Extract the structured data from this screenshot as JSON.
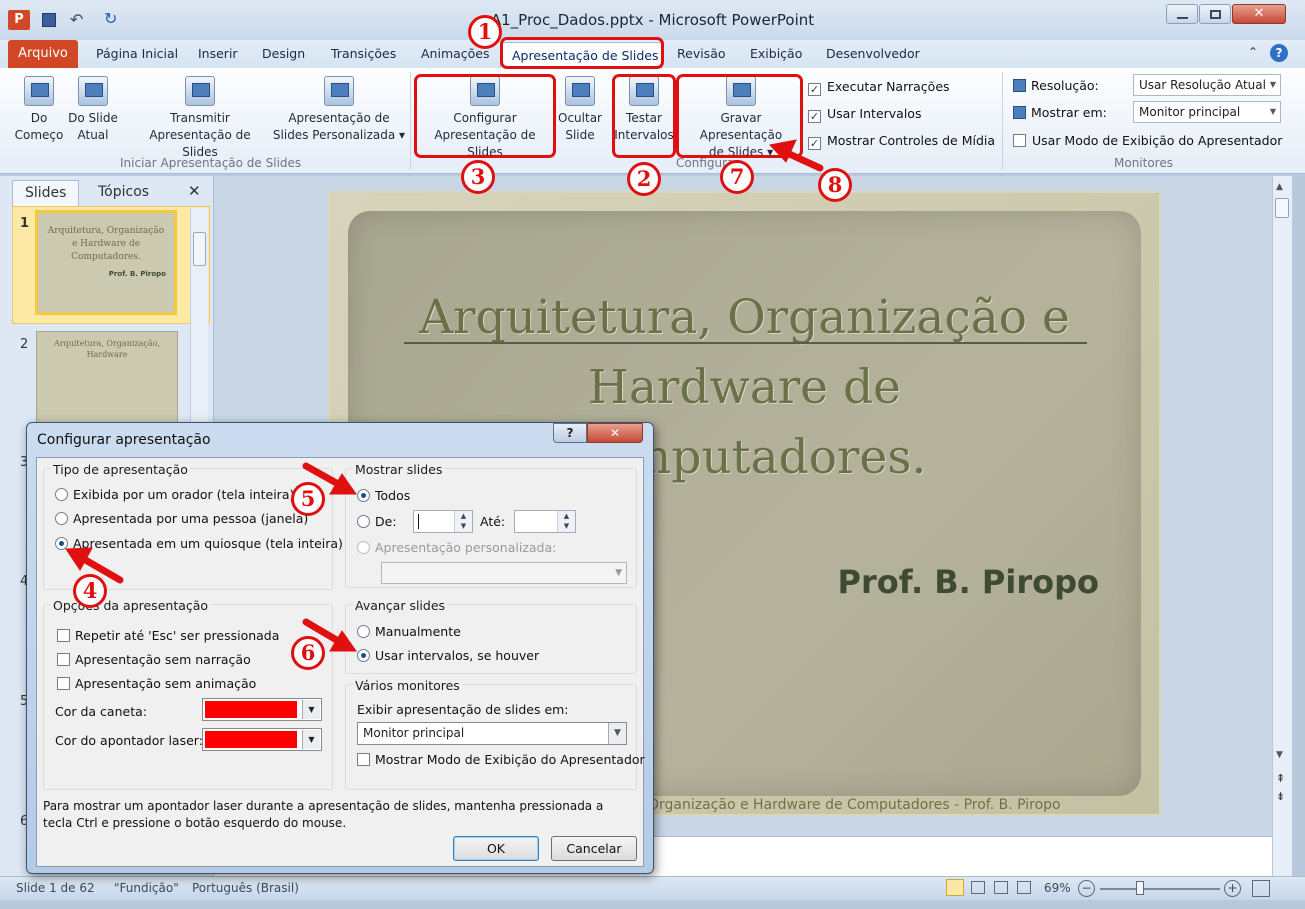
{
  "window": {
    "title": "A1_Proc_Dados.pptx - Microsoft PowerPoint",
    "app_icon": "P"
  },
  "ribbon_tabs": [
    "Arquivo",
    "Página Inicial",
    "Inserir",
    "Design",
    "Transições",
    "Animações",
    "Apresentação de Slides",
    "Revisão",
    "Exibição",
    "Desenvolvedor"
  ],
  "ribbon": {
    "btn_inicio": [
      "Do",
      "Começo"
    ],
    "btn_slide_atual": [
      "Do Slide",
      "Atual"
    ],
    "btn_transmitir": [
      "Transmitir",
      "Apresentação de Slides"
    ],
    "btn_personalizada": [
      "Apresentação de",
      "Slides Personalizada"
    ],
    "group_iniciar": "Iniciar Apresentação de Slides",
    "btn_configurar": [
      "Configurar",
      "Apresentação de Slides"
    ],
    "btn_ocultar": [
      "Ocultar",
      "Slide"
    ],
    "btn_testar": [
      "Testar",
      "Intervalos"
    ],
    "btn_gravar": [
      "Gravar Apresentação",
      "de Slides"
    ],
    "group_configurar": "Configurar",
    "chk_narracoes": "Executar Narrações",
    "chk_intervalos": "Usar Intervalos",
    "chk_controles": "Mostrar Controles de Mídia",
    "resolucao_label": "Resolução:",
    "resolucao_value": "Usar Resolução Atual",
    "mostrar_em_label": "Mostrar em:",
    "mostrar_em_value": "Monitor principal",
    "chk_modo_apresentador": "Usar Modo de Exibição do Apresentador",
    "group_monitores": "Monitores"
  },
  "annotations": [
    "1",
    "2",
    "3",
    "4",
    "5",
    "6",
    "7",
    "8"
  ],
  "left_pane": {
    "tab_slides": "Slides",
    "tab_topicos": "Tópicos",
    "close": "✕",
    "slide_numbers": [
      "1",
      "2",
      "3",
      "4",
      "5",
      "6"
    ],
    "thumb1_title": "Arquitetura, Organização e Hardware de Computadores.",
    "thumb1_author": "Prof. B. Piropo",
    "thumb2_title": "Arquitetura, Organização, Hardware"
  },
  "slide": {
    "title_lines": [
      "Arquitetura, Organização e",
      "Hardware de",
      "Computadores."
    ],
    "author": "Prof. B. Piropo",
    "footer": "Organização e Hardware de Computadores - Prof. B. Piropo"
  },
  "status": {
    "slide_info": "Slide 1 de 62",
    "theme": "\"Fundição\"",
    "language": "Português (Brasil)",
    "zoom": "69%"
  },
  "dialog": {
    "title": "Configurar apresentação",
    "help": "?",
    "close": "✕",
    "tipo_label": "Tipo de apresentação",
    "tipo_opts": [
      "Exibida por um orador (tela inteira)",
      "Apresentada por uma pessoa (janela)",
      "Apresentada em um quiosque (tela inteira)"
    ],
    "tipo_selected": 2,
    "mostrar_label": "Mostrar slides",
    "todos": "Todos",
    "de": "De:",
    "ate": "Até:",
    "personalizada": "Apresentação personalizada:",
    "opcoes_label": "Opções da apresentação",
    "opcoes": [
      "Repetir até 'Esc' ser pressionada",
      "Apresentação sem narração",
      "Apresentação sem animação"
    ],
    "cor_caneta": "Cor da caneta:",
    "cor_laser": "Cor do apontador laser:",
    "pen_color": "#ff0000",
    "avancar_label": "Avançar slides",
    "manual": "Manualmente",
    "usar_intervalos": "Usar intervalos, se houver",
    "monitores_label": "Vários monitores",
    "exibir_em": "Exibir apresentação de slides em:",
    "monitor_value": "Monitor principal",
    "modo_apresentador": "Mostrar Modo de Exibição do Apresentador",
    "hint": "Para mostrar um apontador laser durante a apresentação de slides, mantenha pressionada a tecla Ctrl e pressione o botão esquerdo do mouse.",
    "ok": "OK",
    "cancel": "Cancelar"
  },
  "colors": {
    "accent_red": "#e01010",
    "file_tab": "#d24726"
  }
}
